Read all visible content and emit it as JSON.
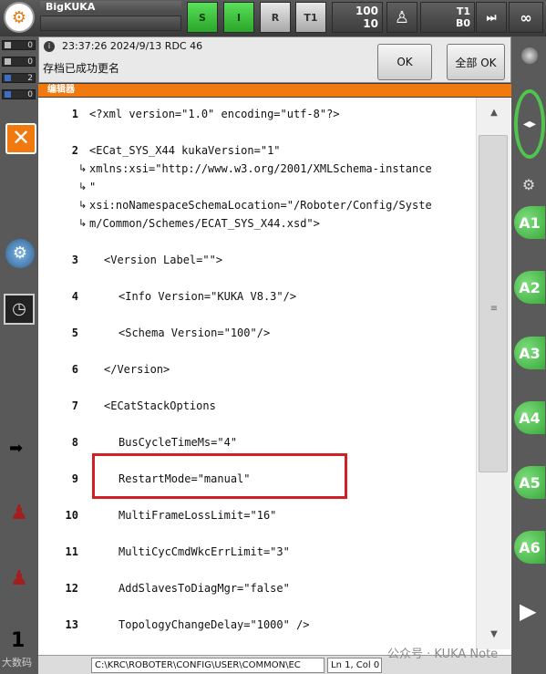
{
  "topbar": {
    "robot_name": "BigKUKA",
    "btn_s": "S",
    "btn_i": "I",
    "btn_r": "R",
    "btn_t1": "T1",
    "override_top": "100",
    "override_bottom": "10",
    "tool_top": "T1",
    "tool_bottom": "B0",
    "infinity": "∞"
  },
  "status_counters": [
    "0",
    "0",
    "2",
    "0"
  ],
  "message": {
    "header": "23:37:26 2024/9/13 RDC 46",
    "text": "存档已成功更名",
    "ok_label": "OK",
    "all_ok_label": "全部 OK"
  },
  "editor": {
    "title": "编辑器",
    "lines": [
      {
        "num": "1",
        "text": "<?xml version=\"1.0\" encoding=\"utf-8\"?>"
      },
      {
        "num": "2",
        "text": "<ECat_SYS_X44 kukaVersion=\"1\""
      },
      {
        "num": "",
        "text": "xmlns:xsi=\"http://www.w3.org/2001/XMLSchema-instance"
      },
      {
        "num": "",
        "text": "\""
      },
      {
        "num": "",
        "text": "xsi:noNamespaceSchemaLocation=\"/Roboter/Config/Syste"
      },
      {
        "num": "",
        "text": "m/Common/Schemes/ECAT_SYS_X44.xsd\">"
      },
      {
        "num": "3",
        "text": "<Version Label=\"\">"
      },
      {
        "num": "4",
        "text": "<Info Version=\"KUKA V8.3\"/>"
      },
      {
        "num": "5",
        "text": "<Schema Version=\"100\"/>"
      },
      {
        "num": "6",
        "text": "</Version>"
      },
      {
        "num": "7",
        "text": "<ECatStackOptions"
      },
      {
        "num": "8",
        "text": "BusCycleTimeMs=\"4\""
      },
      {
        "num": "9",
        "text": "RestartMode=\"manual\""
      },
      {
        "num": "10",
        "text": "MultiFrameLossLimit=\"16\""
      },
      {
        "num": "11",
        "text": "MultiCycCmdWkcErrLimit=\"3\""
      },
      {
        "num": "12",
        "text": "AddSlavesToDiagMgr=\"false\""
      },
      {
        "num": "13",
        "text": "TopologyChangeDelay=\"1000\" />"
      }
    ]
  },
  "statusbar": {
    "path": "C:\\KRC\\ROBOTER\\CONFIG\\USER\\COMMON\\EC",
    "position": "Ln 1, Col 0"
  },
  "left": {
    "bottom_label": "1"
  },
  "right": {
    "a_buttons": [
      "A1",
      "A2",
      "A3",
      "A4",
      "A5",
      "A6"
    ]
  },
  "watermark": {
    "right": "公众号 · KUKA Note",
    "left": "大数码"
  }
}
